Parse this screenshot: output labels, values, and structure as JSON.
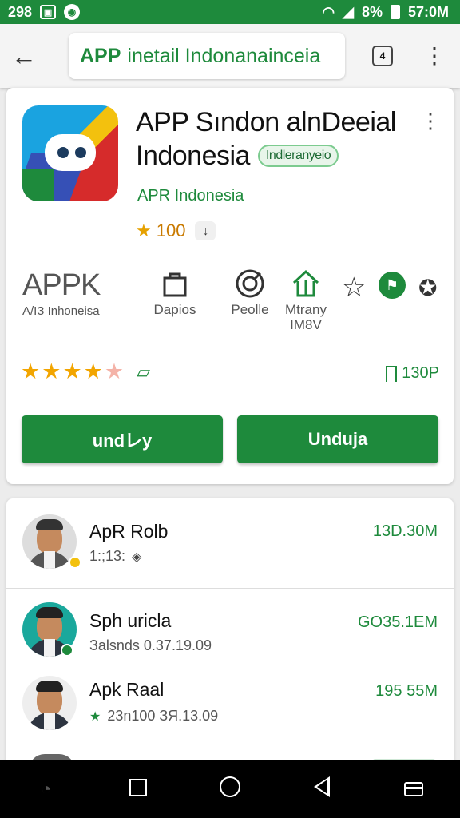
{
  "status_bar": {
    "left_text": "298",
    "battery_pct": "8%",
    "time": "57:0M"
  },
  "toolbar": {
    "url_app": "APP",
    "url_rest": "inetail Indonanainceia",
    "tab_count": "4"
  },
  "app": {
    "title_line1": "APP Sındon alnDeeial",
    "title_line2": "Indonesia",
    "badge": "Indleranyeio",
    "developer": "APR Indonesia",
    "rating": "100",
    "meta": {
      "apk_logo": "APPK",
      "apk_caption": "A/ІЗ Іnhoneіsa",
      "item1_label": "Dapios",
      "item2_label": "Peolle",
      "item3_label_line1": "Mtrany",
      "item3_label_line2": "IМ8V"
    },
    "stars_rating": 4.5,
    "save_count": "130P",
    "button_left": "undレy",
    "button_right": "Unduja"
  },
  "list": {
    "items": [
      {
        "name": "ApR Rolb",
        "sub": "1:;13:",
        "size": "13D.30M"
      },
      {
        "name": "Sph uricla",
        "sub": "Зalsnds 0.37.19.09",
        "size": "GO35.1EM"
      },
      {
        "name": "Apk Raal",
        "sub": "23n100 ЗЯ.13.09",
        "size": "195 55M"
      }
    ]
  },
  "colors": {
    "brand_green": "#1e8a3c",
    "star_gold": "#f2a500"
  }
}
